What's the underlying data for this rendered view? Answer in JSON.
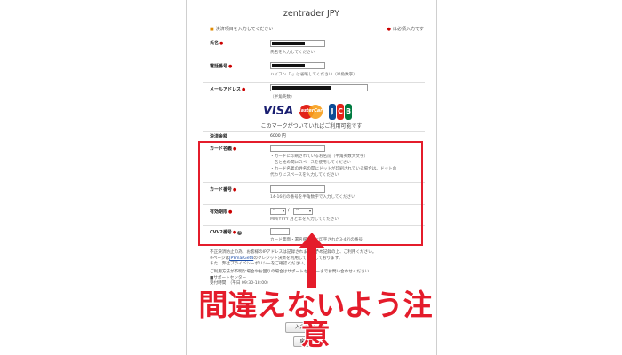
{
  "form": {
    "title": "zentrader JPY",
    "instruction_left": "決済項目を入力してください",
    "instruction_right": "は必須入力です",
    "name_label": "氏名",
    "name_help": "氏名を入力してください",
    "phone_label": "電話番号",
    "phone_help": "ハイフン「-」は省略してください（半角数字）",
    "email_label": "メールアドレス",
    "email_help": "（半角英数）",
    "mark_caption": "このマークがついていればご利用可能です",
    "amount_label": "決済金額",
    "amount_value": "6000 円",
    "card_name_label": "カード名義",
    "card_name_help_1": "・カードに印刷されているお名前（半角英数大文字）",
    "card_name_help_2": "・名と姓の間にスペースを使用してください",
    "card_name_help_3": "・カード名義の姓名の間にドットが印刷されている場合は、ドットの",
    "card_name_help_4": "代わりにスペースを入力してください",
    "card_number_label": "カード番号",
    "card_number_help": "14-16桁の番号を半角数字で入力してください",
    "expiry_label": "有効期限",
    "expiry_month": "--",
    "expiry_sep": "/",
    "expiry_year": "--",
    "expiry_help": "MM/YYYY 月と年を入力してください",
    "cvv_label": "CVV2番号",
    "cvv_help": "カード裏面・署名欄右上に印字された3-4桁の番号",
    "notes_1": "不正決済防止の為、お客様のIPアドレスは記録されます。予め記録の上、ご利用ください。",
    "notes_2_pre": "※ページは",
    "notes_2_link": "JPYmarGet4",
    "notes_2_post": "のクレジット決済を利用して決済しております。",
    "notes_3": "また、弊社プライバシーポリシーをご確認ください。",
    "notes_4": "ご利用方法が不明な場合やお困りの場合はサポートセンターまでお問い合わせください",
    "notes_5": "■サポートセンター",
    "notes_6": "受付時間：（平日 09:30-18:00）",
    "confirm_button": "入力確認",
    "back_button": "戻る"
  },
  "overlay": {
    "warning_text": "間違えないよう注意"
  },
  "card_brands": [
    "VISA",
    "MasterCard",
    "JCB"
  ],
  "colors": {
    "highlight": "#e41c2b",
    "required": "#cc0000"
  }
}
